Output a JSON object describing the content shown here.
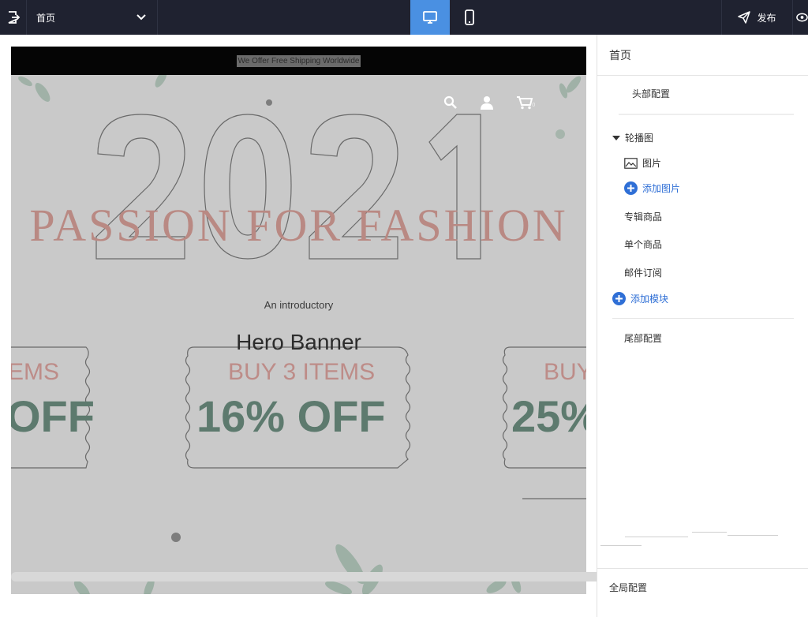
{
  "topbar": {
    "page_select": "首页",
    "publish_label": "发布"
  },
  "preview": {
    "announcement": "We Offer Free Shipping Worldwide",
    "cart_count": "0",
    "hero_year": "2021",
    "hero_title": "PASSION FOR FASHION",
    "hero_intro": "An introductory",
    "hero_banner": "Hero Banner",
    "coupons": [
      {
        "line1": "EMS",
        "line2": "OFF"
      },
      {
        "line1": "BUY 3 ITEMS",
        "line2": "16% OFF"
      },
      {
        "line1": "BUY",
        "line2": "25%"
      }
    ]
  },
  "panel": {
    "title": "首页",
    "header_config": "头部配置",
    "carousel": "轮播图",
    "image": "图片",
    "add_image": "添加图片",
    "featured_products": "专辑商品",
    "single_product": "单个商品",
    "email_subscribe": "邮件订阅",
    "add_module": "添加模块",
    "footer_config": "尾部配置",
    "global_config": "全局配置"
  },
  "colors": {
    "topbar_bg": "#1f2230",
    "active_device": "#4a90e2",
    "link_blue": "#2f6fd6",
    "coupon_pink": "#bd8c88",
    "coupon_green": "#5d7a6e"
  }
}
